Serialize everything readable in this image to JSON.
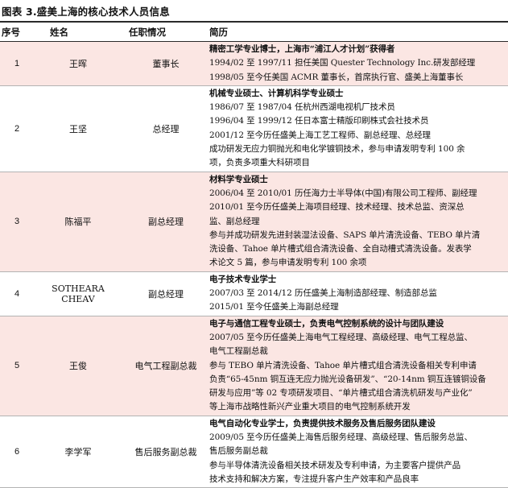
{
  "title": "图表 3.盛美上海的核心技术人员信息",
  "headers": {
    "index": "序号",
    "name": "姓名",
    "role": "任职情况",
    "resume": "简历"
  },
  "rows": [
    {
      "index": "1",
      "name": "王晖",
      "role": "董事长",
      "lines": [
        {
          "text": "精密工学专业博士，上海市“浦江人才计划”获得者",
          "bold": true
        },
        {
          "text": "1994/02 至 1997/11 担任美国 Quester Technology Inc.研发部经理",
          "bold": false
        },
        {
          "text": "1998/05 至今任美国 ACMR 董事长，首席执行官、盛美上海董事长",
          "bold": false
        }
      ]
    },
    {
      "index": "2",
      "name": "王坚",
      "role": "总经理",
      "lines": [
        {
          "text": "机械专业硕士、计算机科学专业硕士",
          "bold": true
        },
        {
          "text": "1986/07 至 1987/04 任杭州西湖电视机厂技术员",
          "bold": false
        },
        {
          "text": "1996/04 至 1999/12 任日本富士精版印刷株式会社技术员",
          "bold": false
        },
        {
          "text": "2001/12 至今历任盛美上海工艺工程师、副总经理、总经理",
          "bold": false
        },
        {
          "text": "成功研发无应力铜抛光和电化学镀铜技术，参与申请发明专利 100 余",
          "bold": false
        },
        {
          "text": "项，负责多项重大科研项目",
          "bold": false
        }
      ]
    },
    {
      "index": "3",
      "name": "陈福平",
      "role": "副总经理",
      "lines": [
        {
          "text": "材料学专业硕士",
          "bold": true
        },
        {
          "text": "2006/04 至 2010/01 历任海力士半导体(中国)有限公司工程师、副经理",
          "bold": false
        },
        {
          "text": "2010/01 至今历任盛美上海项目经理、技术经理、技术总监、资深总",
          "bold": false
        },
        {
          "text": "监、副总经理",
          "bold": false
        },
        {
          "text": "参与并成功研发先进封装湿法设备、SAPS 单片清洗设备、TEBO 单片清",
          "bold": false
        },
        {
          "text": "洗设备、Tahoe 单片槽式组合清洗设备、全自动槽式清洗设备。发表学",
          "bold": false
        },
        {
          "text": "术论文 5 篇，参与申请发明专利 100 余项",
          "bold": false
        }
      ]
    },
    {
      "index": "4",
      "name": "SOTHEARA CHEAV",
      "role": "副总经理",
      "lines": [
        {
          "text": "电子技术专业学士",
          "bold": true
        },
        {
          "text": "2007/03 至 2014/12 历任盛美上海制造部经理、制造部总监",
          "bold": false
        },
        {
          "text": "2015/01 至今任盛美上海副总经理",
          "bold": false
        }
      ]
    },
    {
      "index": "5",
      "name": "王俊",
      "role": "电气工程副总裁",
      "lines": [
        {
          "text": "电子与通信工程专业硕士，负责电气控制系统的设计与团队建设",
          "bold": true
        },
        {
          "text": "2007/05 至今历任盛美上海电气工程经理、高级经理、电气工程总监、",
          "bold": false
        },
        {
          "text": "电气工程副总裁",
          "bold": false
        },
        {
          "text": "参与 TEBO 单片清洗设备、Tahoe 单片槽式组合清洗设备相关专利申请",
          "bold": false
        },
        {
          "text": "负责“65-45nm 铜互连无应力抛光设备研发”、“20-14nm 铜互连镀铜设备",
          "bold": false
        },
        {
          "text": "研发与应用”等 02 专项研发项目、“单片槽式组合清洗机研发与产业化”",
          "bold": false
        },
        {
          "text": "等上海市战略性新兴产业重大项目的电气控制系统开发",
          "bold": false
        }
      ]
    },
    {
      "index": "6",
      "name": "李学军",
      "role": "售后服务副总裁",
      "lines": [
        {
          "text": "电气自动化专业学士，负责提供技术服务及售后服务团队建设",
          "bold": true
        },
        {
          "text": "2009/05 至今历任盛美上海售后服务经理、高级经理、售后服务总监、",
          "bold": false
        },
        {
          "text": "售后服务副总裁",
          "bold": false
        },
        {
          "text": "参与半导体清洗设备相关技术研发及专利申请，为主要客户提供产品",
          "bold": false
        },
        {
          "text": "技术支持和解决方案，专注提升客户生产效率和产品良率",
          "bold": false
        }
      ]
    }
  ]
}
